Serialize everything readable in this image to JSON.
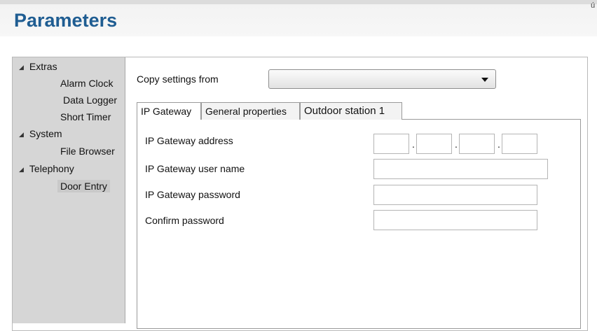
{
  "header": {
    "title": "Parameters",
    "corner_mark": "ú"
  },
  "sidebar": {
    "groups": [
      {
        "label": "Extras",
        "items": [
          "Alarm Clock",
          "Data Logger",
          "Short Timer"
        ]
      },
      {
        "label": "System",
        "items": [
          "File Browser"
        ]
      },
      {
        "label": "Telephony",
        "items": [
          "Door Entry"
        ]
      }
    ],
    "selected_item": "Door Entry",
    "expand_icon": "collapse-triangle-icon"
  },
  "copy_settings": {
    "label": "Copy settings from",
    "value": ""
  },
  "tabs": [
    {
      "label": "IP Gateway",
      "active": true
    },
    {
      "label": "General properties",
      "active": false
    },
    {
      "label": "Outdoor station 1",
      "active": false
    }
  ],
  "form": {
    "ip_address_label": "IP Gateway address",
    "ip_octets": [
      "",
      "",
      "",
      ""
    ],
    "user_name_label": "IP Gateway user name",
    "user_name_value": "",
    "password_label": "IP Gateway password",
    "password_value": "",
    "confirm_label": "Confirm password",
    "confirm_value": ""
  },
  "colors": {
    "title": "#1f5d92",
    "sidebar_bg": "#d6d6d6"
  }
}
